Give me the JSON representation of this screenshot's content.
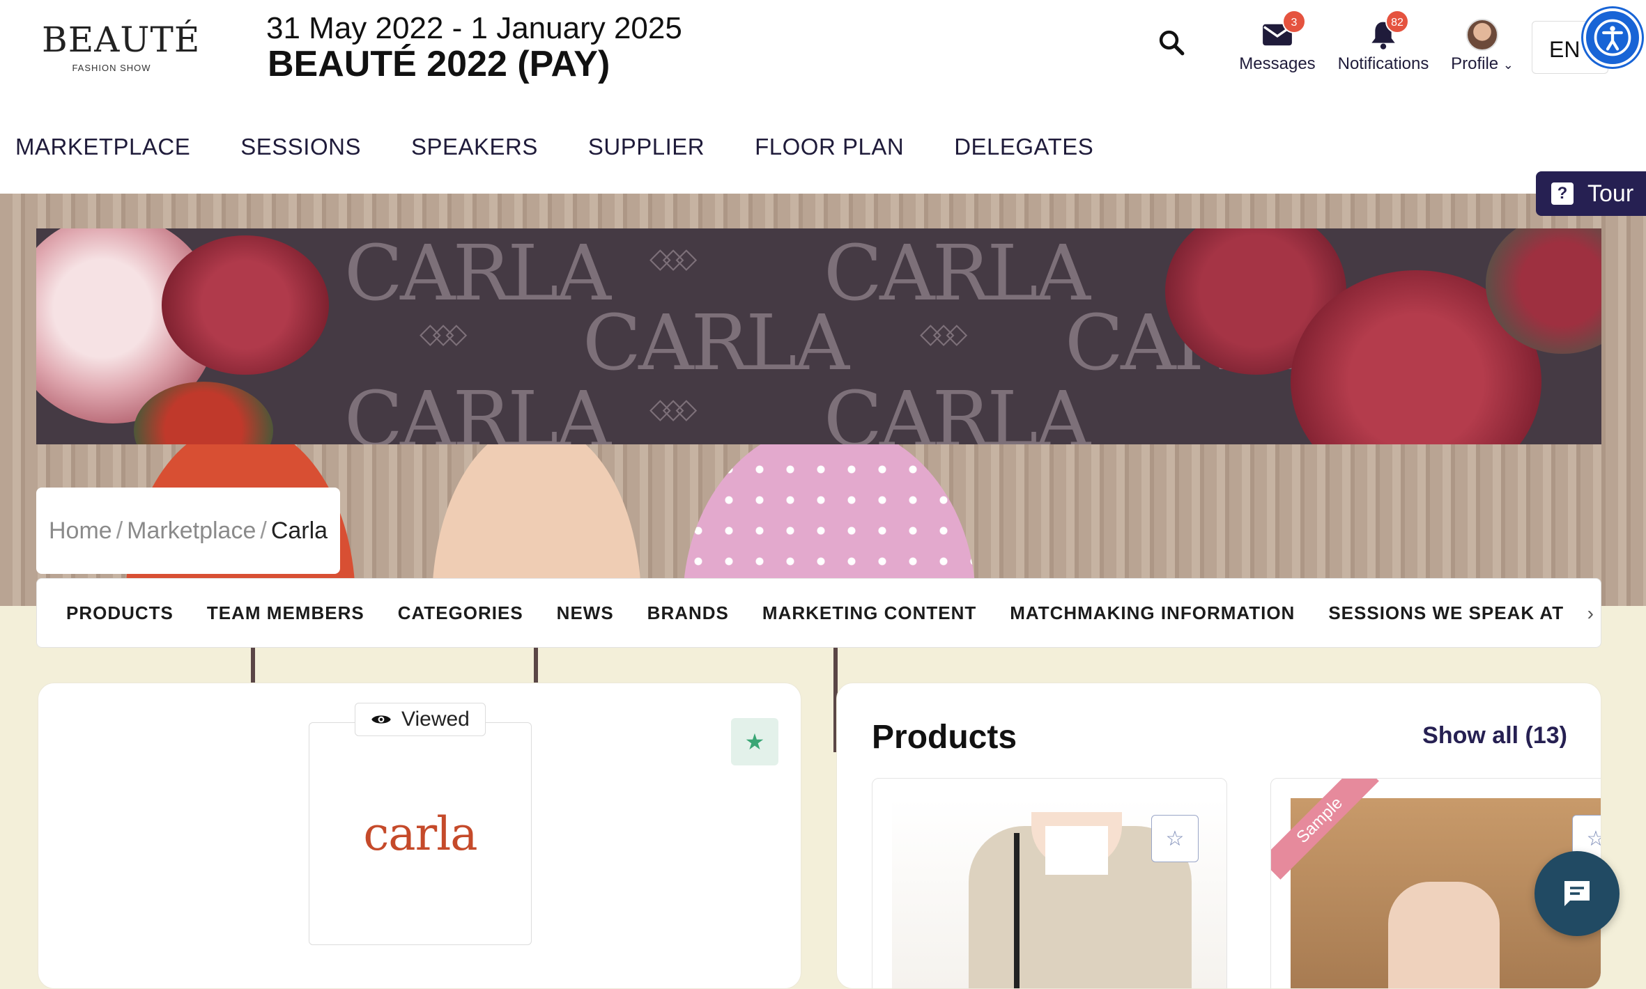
{
  "header": {
    "logo": {
      "wordmark": "BEAUTÉ",
      "subtitle": "FASHION SHOW"
    },
    "event_dates": "31 May 2022 - 1 January 2025",
    "event_title": "BEAUTÉ 2022 (PAY)",
    "messages": {
      "label": "Messages",
      "count": "3"
    },
    "notifications": {
      "label": "Notifications",
      "count": "82"
    },
    "profile": {
      "label": "Profile"
    },
    "language": "EN"
  },
  "nav": {
    "items": [
      "MARKETPLACE",
      "SESSIONS",
      "SPEAKERS",
      "SUPPLIER",
      "FLOOR PLAN",
      "DELEGATES"
    ]
  },
  "tour": {
    "label": "Tour"
  },
  "banner": {
    "watermark": "CARLA"
  },
  "breadcrumb": {
    "home": "Home",
    "marketplace": "Marketplace",
    "current": "Carla",
    "sep": "/"
  },
  "tabs": [
    "PRODUCTS",
    "TEAM MEMBERS",
    "CATEGORIES",
    "NEWS",
    "BRANDS",
    "MARKETING CONTENT",
    "MATCHMAKING INFORMATION",
    "SESSIONS WE SPEAK AT"
  ],
  "company": {
    "viewed_label": "Viewed",
    "logo_text": "carla"
  },
  "products": {
    "title": "Products",
    "show_all": "Show all (13)",
    "ribbon": "Sample"
  },
  "colors": {
    "brand_navy": "#262052",
    "favorite_green": "#3aa675",
    "badge_red": "#e5533f",
    "accessibility_blue": "#1864d6"
  }
}
